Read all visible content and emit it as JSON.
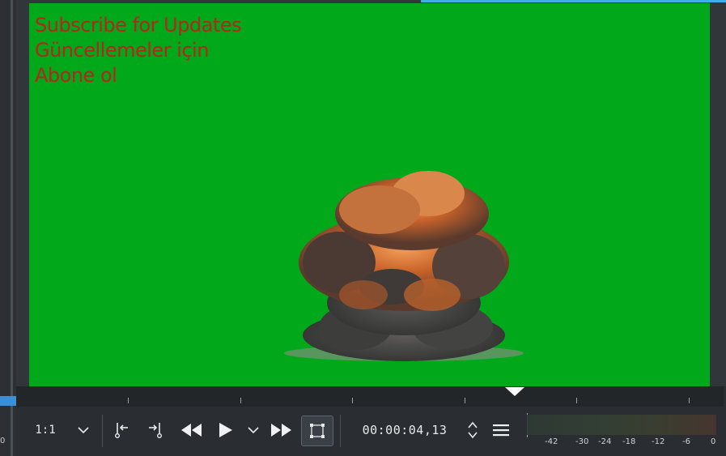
{
  "video_overlay": {
    "lines": [
      "Subscribe for Updates",
      "Güncellemeler için",
      "Abone ol"
    ]
  },
  "left_panel": {
    "value": "0"
  },
  "toolbar": {
    "zoom_value": "1:1",
    "timecode": "00:00:04,13"
  },
  "audio_meter": {
    "scale": [
      "-42",
      "-30",
      "-24",
      "-18",
      "-12",
      "-6",
      "0"
    ]
  },
  "colors": {
    "chroma_green": "#00a81a",
    "overlay_text": "#b5261c",
    "accent": "#3daee9",
    "panel_bg": "#2a2e32"
  },
  "icons": [
    "zoom-dropdown-icon",
    "set-zone-in-icon",
    "set-zone-out-icon",
    "rewind-icon",
    "play-icon",
    "play-options-icon",
    "fast-forward-icon",
    "edit-mask-icon",
    "timecode-spin-icon",
    "monitor-menu-icon"
  ]
}
